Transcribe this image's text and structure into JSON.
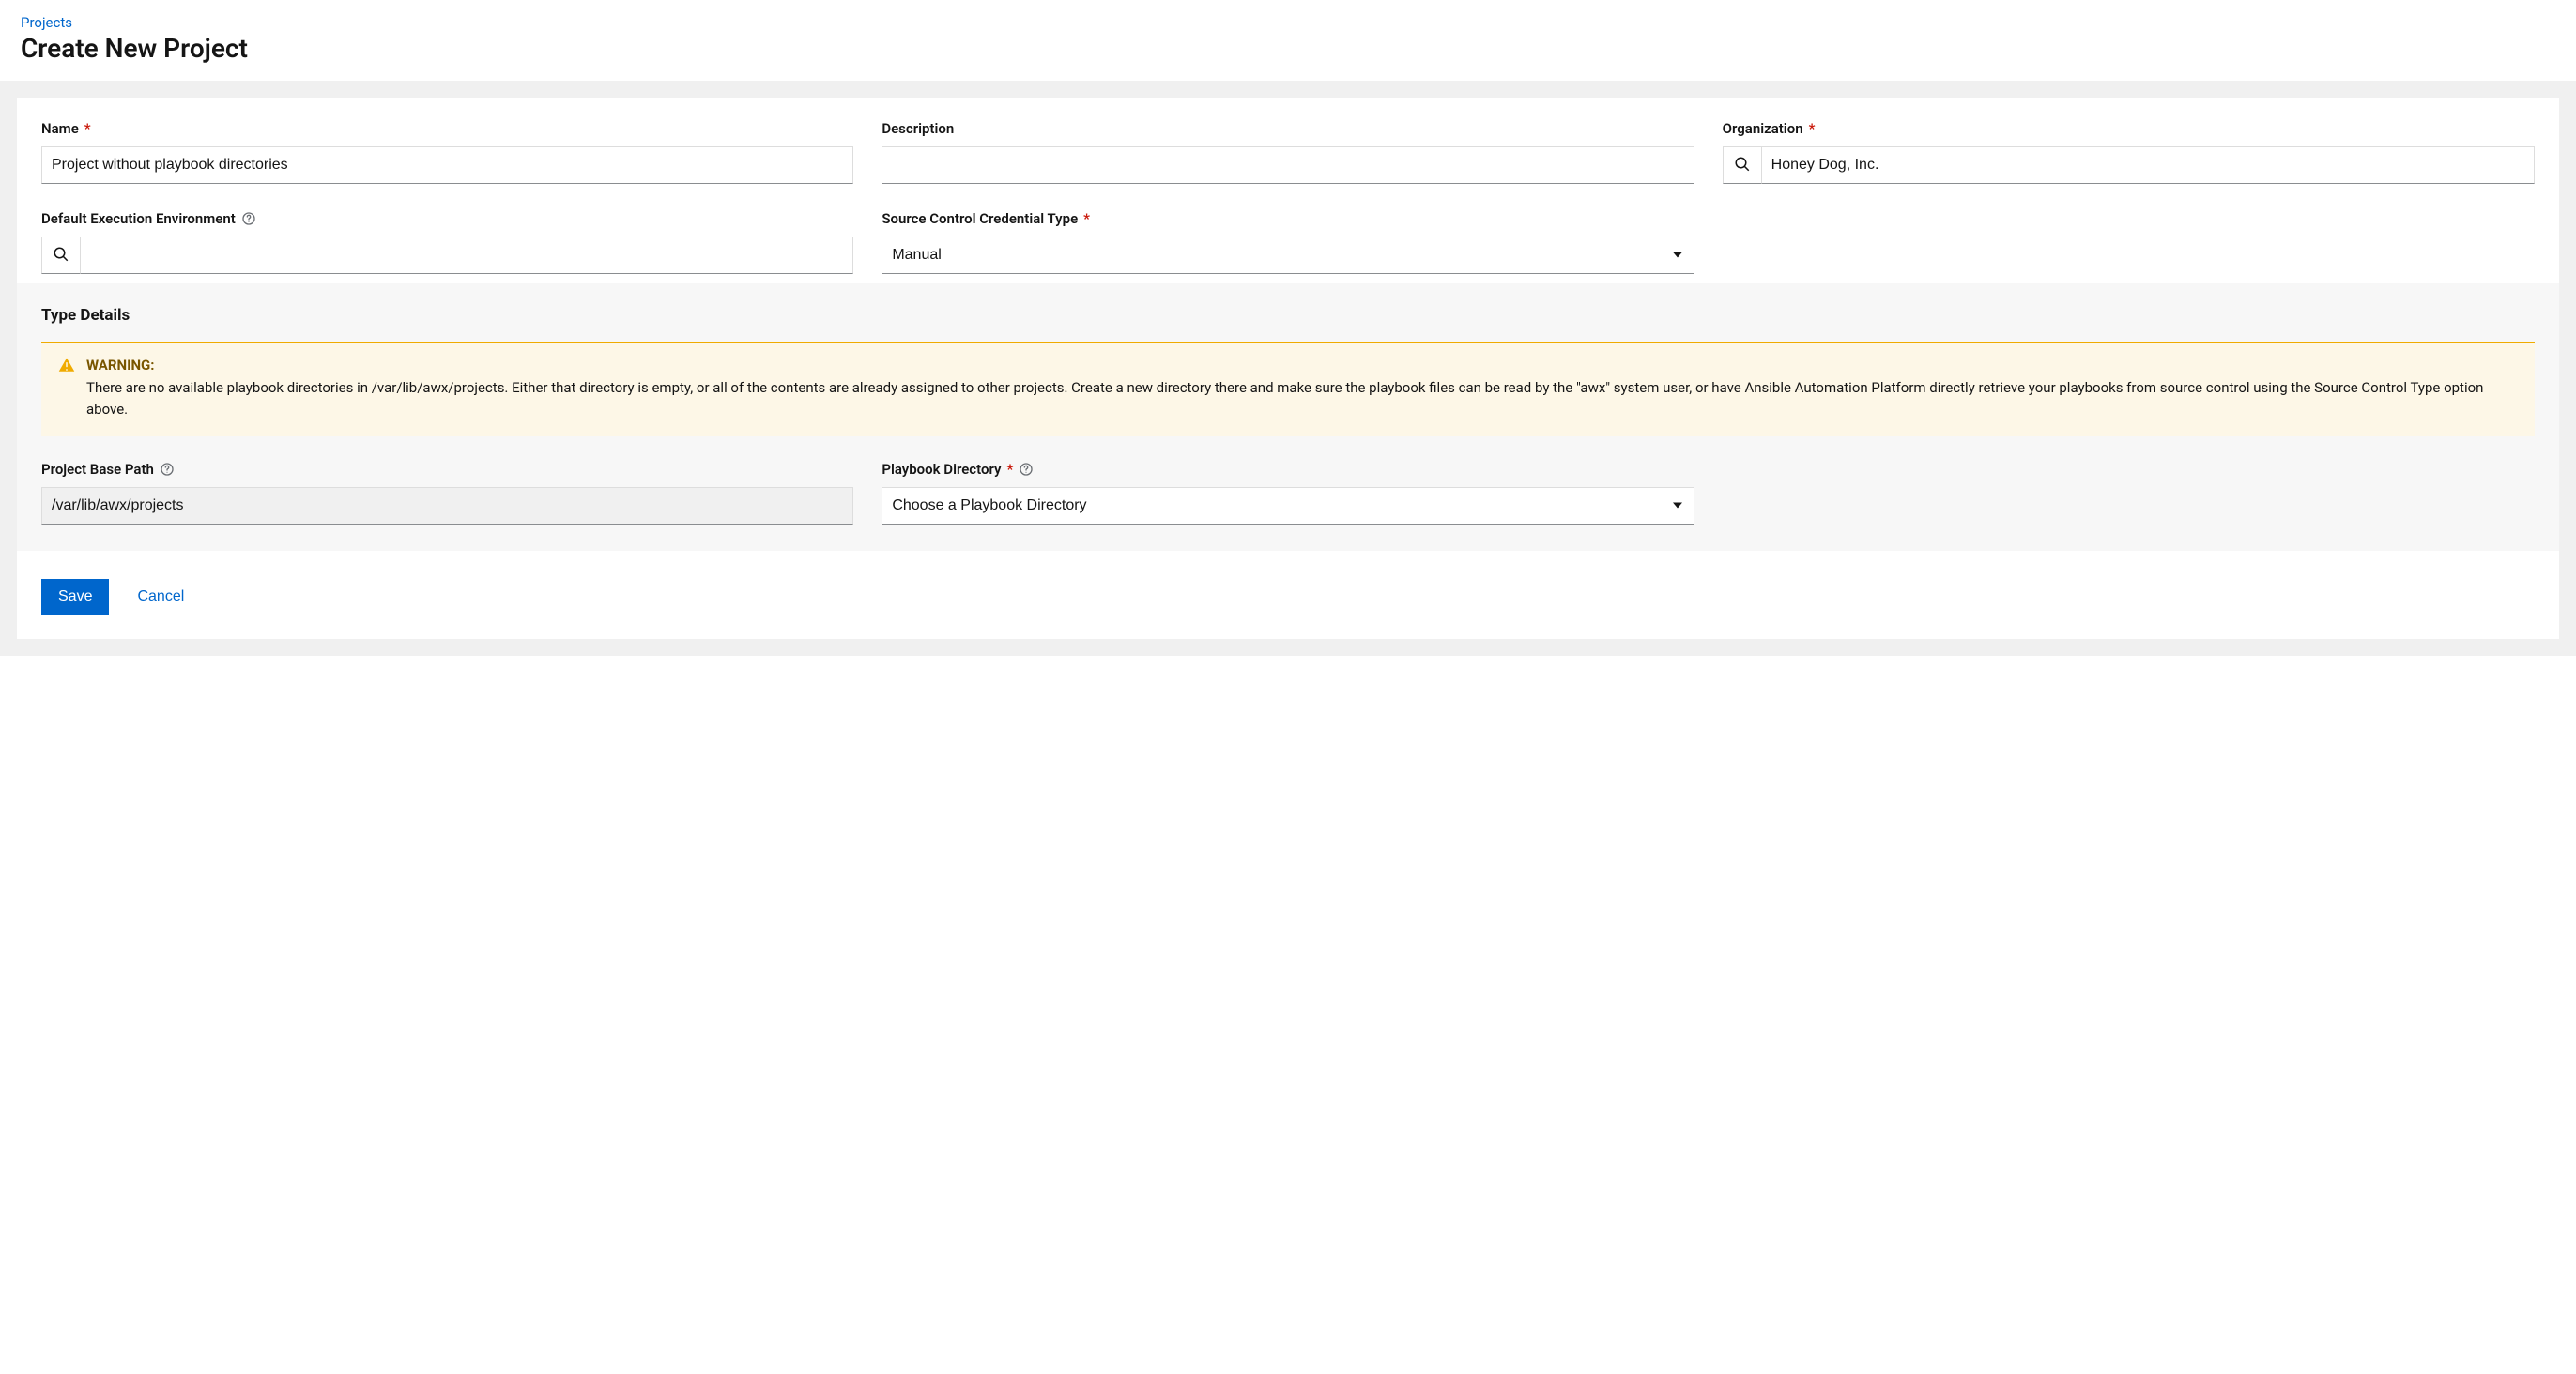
{
  "breadcrumb": {
    "parent": "Projects"
  },
  "page_title": "Create New Project",
  "fields": {
    "name": {
      "label": "Name",
      "value": "Project without playbook directories"
    },
    "description": {
      "label": "Description",
      "value": ""
    },
    "organization": {
      "label": "Organization",
      "value": "Honey Dog, Inc."
    },
    "default_ee": {
      "label": "Default Execution Environment",
      "value": ""
    },
    "sc_type": {
      "label": "Source Control Credential Type",
      "value": "Manual"
    },
    "project_base_path": {
      "label": "Project Base Path",
      "value": "/var/lib/awx/projects"
    },
    "playbook_dir": {
      "label": "Playbook Directory",
      "value": "Choose a Playbook Directory"
    }
  },
  "type_details_title": "Type Details",
  "warning": {
    "title": "WARNING:",
    "text": "There are no available playbook directories in /var/lib/awx/projects. Either that directory is empty, or all of the contents are already assigned to other projects. Create a new directory there and make sure the playbook files can be read by the \"awx\" system user, or have Ansible Automation Platform directly retrieve your playbooks from source control using the Source Control Type option above."
  },
  "actions": {
    "save": "Save",
    "cancel": "Cancel"
  }
}
